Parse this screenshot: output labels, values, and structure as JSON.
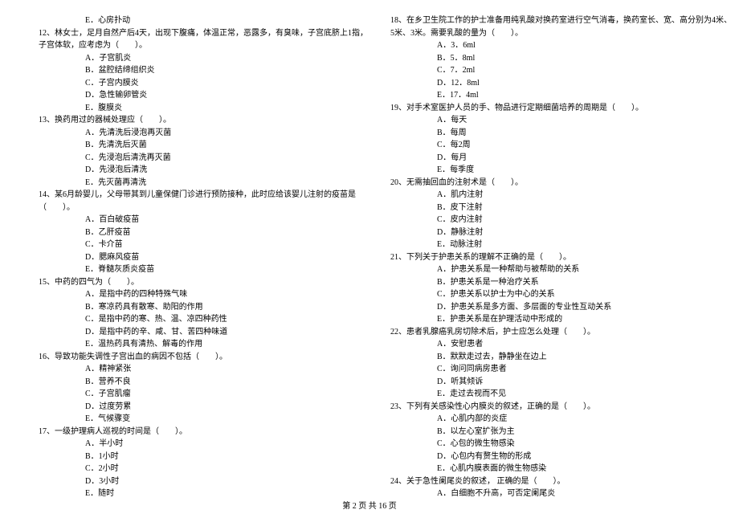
{
  "left": [
    {
      "cls": "q-opt-e",
      "text": "E．心房扑动"
    },
    {
      "cls": "q-stem",
      "text": "12、林女士，足月自然产后4天，出现下腹痛，体温正常，恶露多，有臭味，子宫底脐上1指，"
    },
    {
      "cls": "q-stem",
      "text": "子宫体软，应考虑为（　　）。"
    },
    {
      "cls": "q-opt",
      "text": "A．子宫肌炎"
    },
    {
      "cls": "q-opt",
      "text": "B．盆腔结缔组织炎"
    },
    {
      "cls": "q-opt",
      "text": "C．子宫内膜炎"
    },
    {
      "cls": "q-opt",
      "text": "D．急性输卵管炎"
    },
    {
      "cls": "q-opt",
      "text": "E．腹膜炎"
    },
    {
      "cls": "q-stem",
      "text": "13、换药用过的器械处理应（　　）。"
    },
    {
      "cls": "q-opt",
      "text": "A．先清洗后浸泡再灭菌"
    },
    {
      "cls": "q-opt",
      "text": "B．先清洗后灭菌"
    },
    {
      "cls": "q-opt",
      "text": "C．先浸泡后清洗再灭菌"
    },
    {
      "cls": "q-opt",
      "text": "D．先浸泡后清洗"
    },
    {
      "cls": "q-opt",
      "text": "E．先灭菌再清洗"
    },
    {
      "cls": "q-stem",
      "text": "14、某6月龄婴儿，父母带其到儿童保健门诊进行预防接种，此时应给该婴儿注射的疫苗是"
    },
    {
      "cls": "q-stem",
      "text": "（　　）。"
    },
    {
      "cls": "q-opt",
      "text": "A．百白破疫苗"
    },
    {
      "cls": "q-opt",
      "text": "B．乙肝疫苗"
    },
    {
      "cls": "q-opt",
      "text": "C．卡介苗"
    },
    {
      "cls": "q-opt",
      "text": "D．腮麻风疫苗"
    },
    {
      "cls": "q-opt",
      "text": "E．脊髓灰质炎疫苗"
    },
    {
      "cls": "q-stem",
      "text": "15、中药的四气为（　　）。"
    },
    {
      "cls": "q-opt",
      "text": "A．是指中药的四种特殊气味"
    },
    {
      "cls": "q-opt",
      "text": "B．寒凉药具有散寒、助阳的作用"
    },
    {
      "cls": "q-opt",
      "text": "C．是指中药的寒、热、温、凉四种药性"
    },
    {
      "cls": "q-opt",
      "text": "D．是指中药的辛、咸、甘、苦四种味道"
    },
    {
      "cls": "q-opt",
      "text": "E．温热药具有清热、解毒的作用"
    },
    {
      "cls": "q-stem",
      "text": "16、导致功能失调性子宫出血的病因不包括（　　）。"
    },
    {
      "cls": "q-opt",
      "text": "A．精神紧张"
    },
    {
      "cls": "q-opt",
      "text": "B．营养不良"
    },
    {
      "cls": "q-opt",
      "text": "C．子宫肌瘤"
    },
    {
      "cls": "q-opt",
      "text": "D．过度劳累"
    },
    {
      "cls": "q-opt",
      "text": "E．气候骤变"
    },
    {
      "cls": "q-stem",
      "text": "17、一级护理病人巡视的时间是（　　）。"
    },
    {
      "cls": "q-opt",
      "text": "A．半小时"
    },
    {
      "cls": "q-opt",
      "text": "B．1小时"
    },
    {
      "cls": "q-opt",
      "text": "C．2小时"
    },
    {
      "cls": "q-opt",
      "text": "D．3小时"
    },
    {
      "cls": "q-opt",
      "text": "E．随时"
    }
  ],
  "right": [
    {
      "cls": "q-stem",
      "text": "18、在乡卫生院工作的护士准备用纯乳酸对换药室进行空气消毒，换药室长、宽、高分别为4米、"
    },
    {
      "cls": "q-stem",
      "text": "5米、3米。需要乳酸的量为（　　）。"
    },
    {
      "cls": "q-opt",
      "text": "A．3．6ml"
    },
    {
      "cls": "q-opt",
      "text": "B．5．8ml"
    },
    {
      "cls": "q-opt",
      "text": "C．7．2ml"
    },
    {
      "cls": "q-opt",
      "text": "D．12．8ml"
    },
    {
      "cls": "q-opt",
      "text": "E．17．4ml"
    },
    {
      "cls": "q-stem",
      "text": "19、对手术室医护人员的手、物品进行定期细菌培养的周期是（　　）。"
    },
    {
      "cls": "q-opt",
      "text": "A．每天"
    },
    {
      "cls": "q-opt",
      "text": "B．每周"
    },
    {
      "cls": "q-opt",
      "text": "C．每2周"
    },
    {
      "cls": "q-opt",
      "text": "D．每月"
    },
    {
      "cls": "q-opt",
      "text": "E．每季度"
    },
    {
      "cls": "q-stem",
      "text": "20、无需抽回血的注射术是（　　）。"
    },
    {
      "cls": "q-opt",
      "text": "A．肌内注射"
    },
    {
      "cls": "q-opt",
      "text": "B．皮下注射"
    },
    {
      "cls": "q-opt",
      "text": "C．皮内注射"
    },
    {
      "cls": "q-opt",
      "text": "D．静脉注射"
    },
    {
      "cls": "q-opt",
      "text": "E．动脉注射"
    },
    {
      "cls": "q-stem",
      "text": "21、下列关于护患关系的理解不正确的是（　　）。"
    },
    {
      "cls": "q-opt",
      "text": "A．护患关系是一种帮助与被帮助的关系"
    },
    {
      "cls": "q-opt",
      "text": "B．护患关系是一种治疗关系"
    },
    {
      "cls": "q-opt",
      "text": "C．护患关系以护士为中心的关系"
    },
    {
      "cls": "q-opt",
      "text": "D．护患关系是多方面、多层面的专业性互动关系"
    },
    {
      "cls": "q-opt",
      "text": "E．护患关系是在护理活动中形成的"
    },
    {
      "cls": "q-stem",
      "text": "22、患者乳腺癌乳房切除术后，护士应怎么处理（　　）。"
    },
    {
      "cls": "q-opt",
      "text": "A．安慰患者"
    },
    {
      "cls": "q-opt",
      "text": "B．默默走过去，静静坐在边上"
    },
    {
      "cls": "q-opt",
      "text": "C．询问同病房患者"
    },
    {
      "cls": "q-opt",
      "text": "D．听其倾诉"
    },
    {
      "cls": "q-opt",
      "text": "E．走过去视而不见"
    },
    {
      "cls": "q-stem",
      "text": "23、下列有关感染性心内膜炎的叙述，正确的是（　　）。"
    },
    {
      "cls": "q-opt",
      "text": "A．心肌内部的炎症"
    },
    {
      "cls": "q-opt",
      "text": "B．以左心室扩张为主"
    },
    {
      "cls": "q-opt",
      "text": "C．心包的微生物感染"
    },
    {
      "cls": "q-opt",
      "text": "D．心包内有赘生物的形成"
    },
    {
      "cls": "q-opt",
      "text": "E．心肌内膜表面的微生物感染"
    },
    {
      "cls": "q-stem",
      "text": "24、关于急性阑尾炎的叙述， 正确的是（　　）。"
    },
    {
      "cls": "q-opt",
      "text": "A．白细胞不升高，可否定阑尾炎"
    }
  ],
  "footer": "第 2 页 共 16 页"
}
